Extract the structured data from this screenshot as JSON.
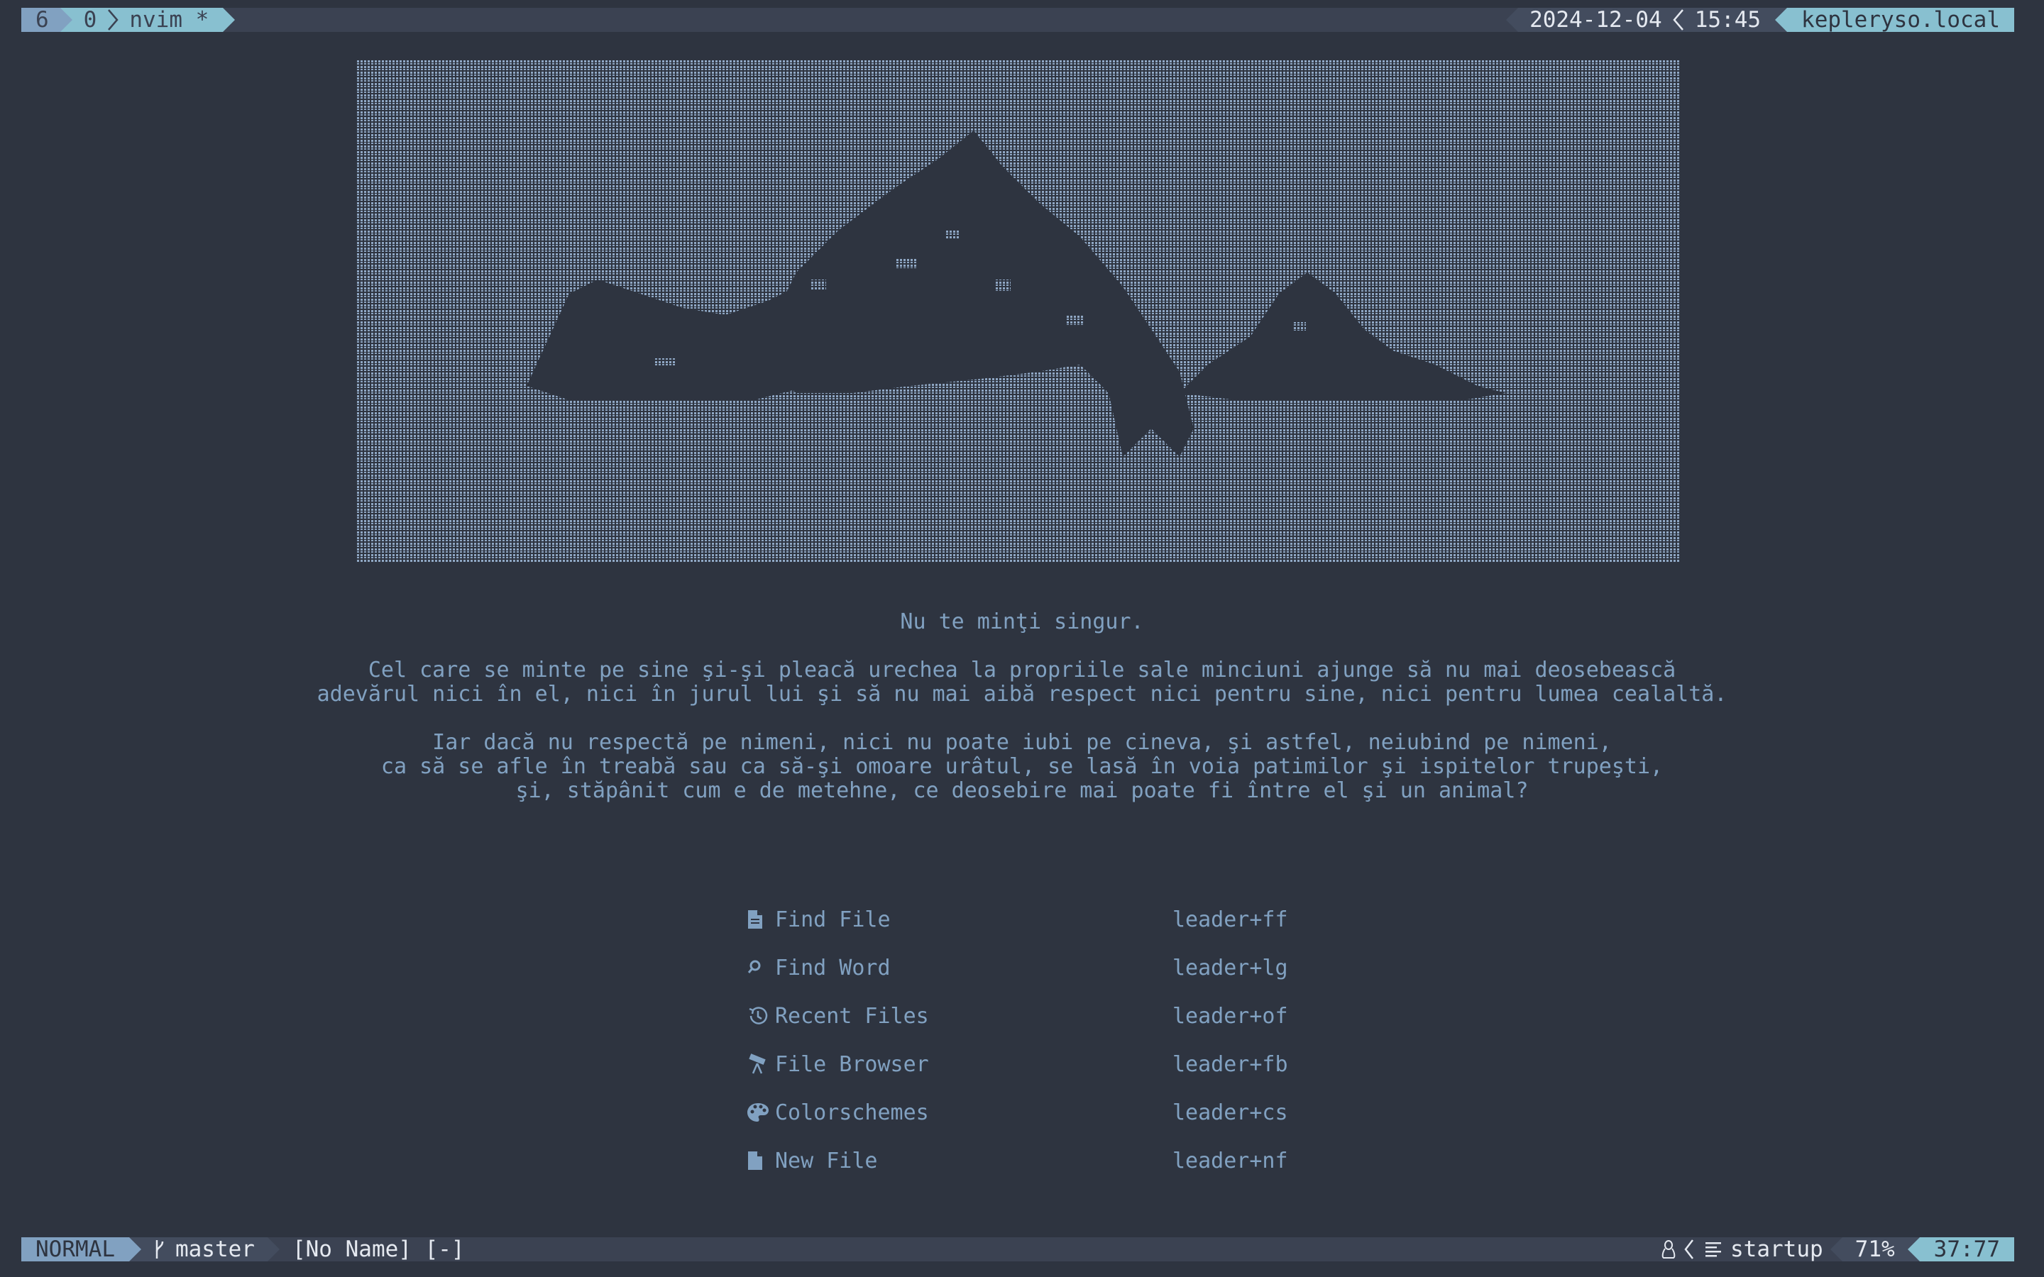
{
  "tmux": {
    "session_index": "6",
    "window_index": "0",
    "window_name": "nvim *",
    "date": "2024-12-04",
    "time": "15:45",
    "hostname": "kepleryso.local"
  },
  "quote": {
    "title": "Nu te minţi singur.",
    "paragraph1": [
      "Cel care se minte pe sine şi-şi pleacă urechea la propriile sale minciuni ajunge să nu mai deosebească",
      "adevărul nici în el, nici în jurul lui şi să nu mai aibă respect nici pentru sine, nici pentru lumea cealaltă."
    ],
    "paragraph2": [
      "Iar dacă nu respectă pe nimeni, nici nu poate iubi pe cineva, şi astfel, neiubind pe nimeni,",
      "ca să se afle în treabă sau ca să-şi omoare urâtul, se lasă în voia patimilor şi ispitelor trupeşti,",
      "şi, stăpânit cum e de metehne, ce deosebire mai poate fi între el şi un animal?"
    ]
  },
  "menu": [
    {
      "icon": "file-icon",
      "label": "Find File",
      "shortcut": "leader+ff"
    },
    {
      "icon": "search-icon",
      "label": "Find Word",
      "shortcut": "leader+lg"
    },
    {
      "icon": "history-icon",
      "label": "Recent Files",
      "shortcut": "leader+of"
    },
    {
      "icon": "telescope-icon",
      "label": "File Browser",
      "shortcut": "leader+fb"
    },
    {
      "icon": "palette-icon",
      "label": "Colorschemes",
      "shortcut": "leader+cs"
    },
    {
      "icon": "new-file-icon",
      "label": "New File",
      "shortcut": "leader+nf"
    }
  ],
  "statusline": {
    "mode": "NORMAL",
    "branch": "master",
    "filename": "[No Name] [-]",
    "filetype": "startup",
    "progress": "71%",
    "position": "37:77"
  },
  "colors": {
    "background": "#2e3440",
    "bar": "#3b4252",
    "accent_blue": "#81a1c1",
    "accent_cyan": "#88c0d0",
    "text": "#e5e9f0"
  }
}
